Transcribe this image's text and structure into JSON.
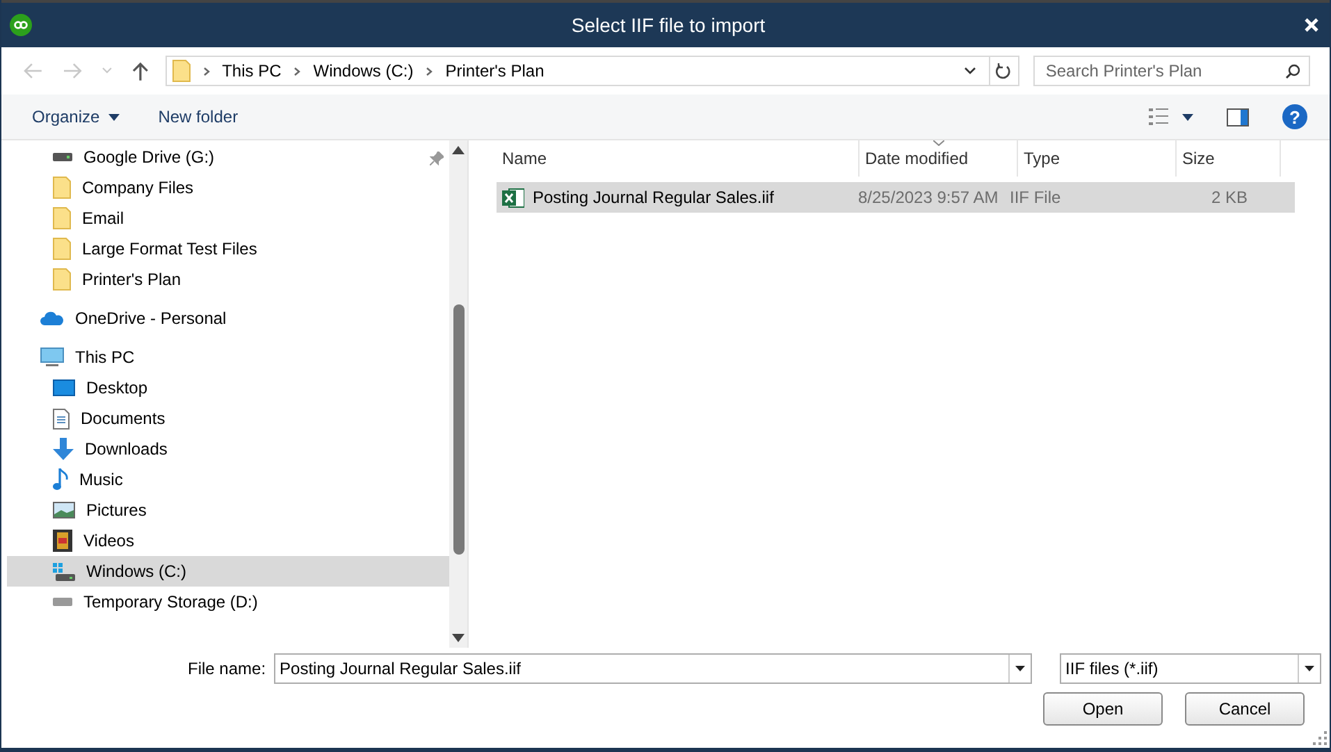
{
  "window": {
    "title": "Select IIF file to import"
  },
  "address": {
    "path": [
      {
        "label": "This PC"
      },
      {
        "label": "Windows (C:)"
      },
      {
        "label": "Printer's Plan"
      }
    ],
    "search_placeholder": "Search Printer's Plan"
  },
  "toolbar": {
    "organize": "Organize",
    "new_folder": "New folder",
    "help": "?"
  },
  "quick_access_items": [
    {
      "label": "Google Drive (G:)",
      "kind": "drive",
      "pinned": true,
      "selected": false
    },
    {
      "label": "Company Files",
      "kind": "folder",
      "pinned": false,
      "selected": false
    },
    {
      "label": "Email",
      "kind": "folder",
      "pinned": false,
      "selected": false
    },
    {
      "label": "Large Format Test Files",
      "kind": "folder",
      "pinned": false,
      "selected": false
    },
    {
      "label": "Printer's Plan",
      "kind": "folder",
      "pinned": false,
      "selected": false
    }
  ],
  "tree": [
    {
      "label": "OneDrive - Personal",
      "kind": "cloud",
      "selected": false
    },
    {
      "label": "This PC",
      "kind": "pc",
      "selected": false,
      "children": [
        {
          "label": "Desktop",
          "kind": "desktop",
          "selected": false
        },
        {
          "label": "Documents",
          "kind": "documents",
          "selected": false
        },
        {
          "label": "Downloads",
          "kind": "downloads",
          "selected": false
        },
        {
          "label": "Music",
          "kind": "music",
          "selected": false
        },
        {
          "label": "Pictures",
          "kind": "pictures",
          "selected": false
        },
        {
          "label": "Videos",
          "kind": "videos",
          "selected": false
        },
        {
          "label": "Windows (C:)",
          "kind": "windows-drive",
          "selected": true
        },
        {
          "label": "Temporary Storage (D:)",
          "kind": "drive",
          "selected": false
        }
      ]
    }
  ],
  "table": {
    "columns": [
      {
        "label": "Name",
        "sorted": false
      },
      {
        "label": "Date modified",
        "sorted": true
      },
      {
        "label": "Type",
        "sorted": false
      },
      {
        "label": "Size",
        "sorted": false
      }
    ],
    "rows": [
      {
        "name": "Posting Journal Regular Sales.iif",
        "date_modified": "8/25/2023 9:57 AM",
        "type": "IIF File",
        "size": "2 KB",
        "selected": true
      }
    ]
  },
  "footer": {
    "file_name_label": "File name:",
    "file_name": "Posting Journal Regular Sales.iif",
    "file_type": "IIF files (*.iif)",
    "buttons": [
      "Open",
      "Cancel"
    ]
  }
}
